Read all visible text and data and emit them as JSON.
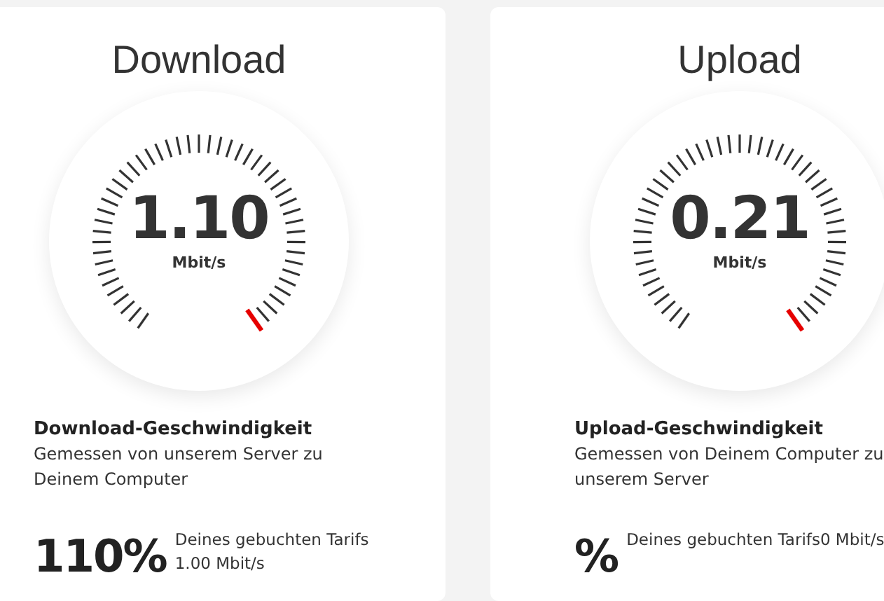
{
  "cards": [
    {
      "title": "Download",
      "speed": "1.10",
      "unit": "Mbit/s",
      "heading": "Download-Geschwindigkeit",
      "description": "Gemessen von unserem Server zu Deinem Computer",
      "percent": "110%",
      "tariff_label": "Deines gebuchten Tarifs",
      "tariff_value": "1.00 Mbit/s"
    },
    {
      "title": "Upload",
      "speed": "0.21",
      "unit": "Mbit/s",
      "heading": "Upload-Geschwindigkeit",
      "description": "Gemessen von Deinem Computer zu unserem Server",
      "percent": "%",
      "tariff_label": "Deines gebuchten Tarifs",
      "tariff_value": "0 Mbit/s"
    }
  ]
}
